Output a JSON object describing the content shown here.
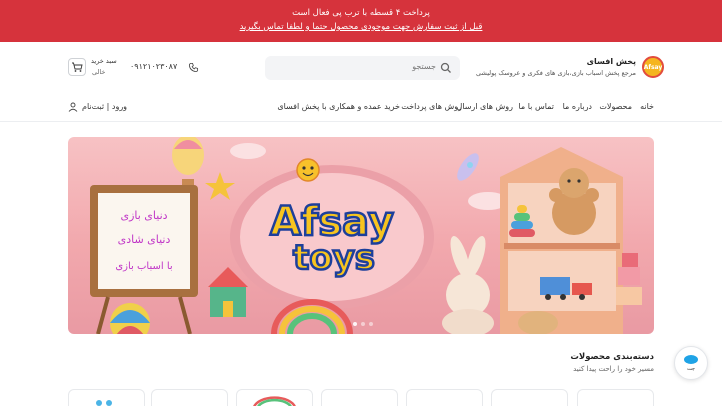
{
  "promo": {
    "line1": "پرداخت ۴ قسطه با ترب پی فعال است",
    "line2": "قبل از ثبت سفارش جهت موجودی محصول حتما و لطفا تماس بگیرید"
  },
  "header": {
    "logo_text": "Afsay",
    "brand_name": "پخش افسای",
    "brand_tagline": "مرجع پخش اسباب بازی،بازی های فکری و عروسک پولیشی",
    "search_placeholder": "جستجو",
    "phone": "۰۹۱۲۱۰۲۳۰۸۷",
    "cart_title": "سبد خرید",
    "cart_status": "خالی"
  },
  "nav": {
    "items": [
      "خانه",
      "محصولات",
      "درباره ما",
      "تماس با ما",
      "روش های ارسال",
      "روش های پرداخت",
      "خرید عمده و همکاری با پخش افسای"
    ],
    "login": "ورود | ثبت‌نام"
  },
  "banner": {
    "logo_word1": "Afsay",
    "logo_word2": "toys",
    "board_line1": "دنیای بازی",
    "board_line2": "دنیای شادی",
    "board_line3": "با اسباب بازی"
  },
  "categories": {
    "title": "دسته‌بندی محصولات",
    "subtitle": "مسیر خود را راحت پیدا کنید"
  },
  "chat": {
    "label": "چت"
  },
  "colors": {
    "promo_bg": "#d6333c",
    "banner_pink": "#f2a8ad",
    "logo_yellow": "#f5c41f"
  }
}
